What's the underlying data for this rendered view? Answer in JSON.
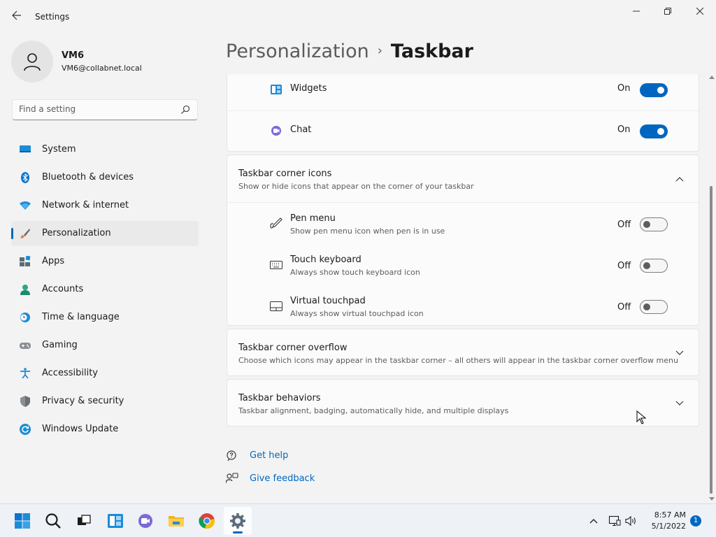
{
  "window": {
    "title": "Settings"
  },
  "user": {
    "name": "VM6",
    "email": "VM6@collabnet.local"
  },
  "search": {
    "placeholder": "Find a setting"
  },
  "sidebar": {
    "items": [
      {
        "label": "System",
        "icon": "monitor-icon"
      },
      {
        "label": "Bluetooth & devices",
        "icon": "bluetooth-icon"
      },
      {
        "label": "Network & internet",
        "icon": "wifi-icon"
      },
      {
        "label": "Personalization",
        "icon": "brush-icon",
        "active": true
      },
      {
        "label": "Apps",
        "icon": "apps-icon"
      },
      {
        "label": "Accounts",
        "icon": "person-icon"
      },
      {
        "label": "Time & language",
        "icon": "clock-globe-icon"
      },
      {
        "label": "Gaming",
        "icon": "gamepad-icon"
      },
      {
        "label": "Accessibility",
        "icon": "accessibility-icon"
      },
      {
        "label": "Privacy & security",
        "icon": "shield-icon"
      },
      {
        "label": "Windows Update",
        "icon": "refresh-icon"
      }
    ]
  },
  "breadcrumb": {
    "parent": "Personalization",
    "separator": "›",
    "current": "Taskbar"
  },
  "taskbar_items": {
    "widgets": {
      "label": "Widgets",
      "state": "On"
    },
    "chat": {
      "label": "Chat",
      "state": "On"
    }
  },
  "corner_icons": {
    "title": "Taskbar corner icons",
    "description": "Show or hide icons that appear on the corner of your taskbar",
    "items": [
      {
        "title": "Pen menu",
        "description": "Show pen menu icon when pen is in use",
        "state": "Off"
      },
      {
        "title": "Touch keyboard",
        "description": "Always show touch keyboard icon",
        "state": "Off"
      },
      {
        "title": "Virtual touchpad",
        "description": "Always show virtual touchpad icon",
        "state": "Off"
      }
    ]
  },
  "corner_overflow": {
    "title": "Taskbar corner overflow",
    "description": "Choose which icons may appear in the taskbar corner – all others will appear in the taskbar corner overflow menu"
  },
  "behaviors": {
    "title": "Taskbar behaviors",
    "description": "Taskbar alignment, badging, automatically hide, and multiple displays"
  },
  "links": {
    "help": "Get help",
    "feedback": "Give feedback"
  },
  "system_taskbar": {
    "time": "8:57 AM",
    "date": "5/1/2022",
    "notification_count": "1"
  },
  "colors": {
    "accent": "#0067c0",
    "background": "#f3f3f3",
    "card": "#fbfbfb"
  }
}
